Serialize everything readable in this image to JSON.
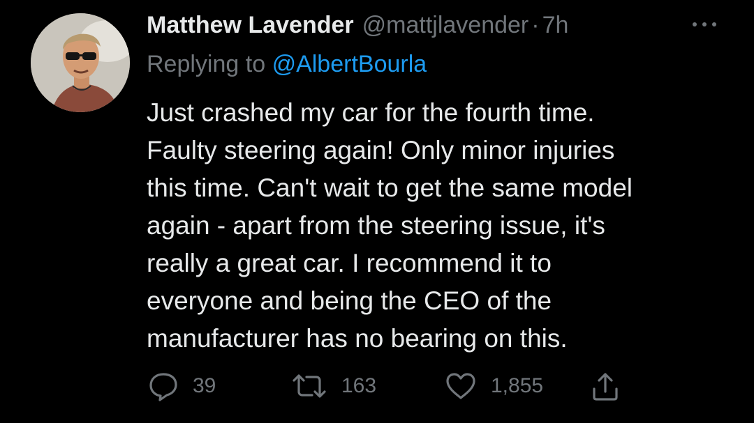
{
  "tweet": {
    "author": {
      "display_name": "Matthew Lavender",
      "handle": "@mattjlavender",
      "separator": "·",
      "time": "7h",
      "avatar_icon": "profile-photo"
    },
    "reply": {
      "prefix": "Replying to",
      "handle": "@AlbertBourla"
    },
    "body_lines": [
      "Just crashed my car for the fourth time.",
      "Faulty steering again! Only minor injuries",
      "this time. Can't wait to get the same model",
      "again - apart from the steering issue, it's",
      "really a great car. I recommend it to",
      "everyone and being the CEO of the",
      "manufacturer has no bearing on this."
    ],
    "actions": {
      "reply": {
        "icon": "comment-icon",
        "count": "39"
      },
      "retweet": {
        "icon": "retweet-icon",
        "count": "163"
      },
      "like": {
        "icon": "heart-icon",
        "count": "1,855"
      },
      "share": {
        "icon": "share-icon"
      }
    },
    "more_icon": "more-options-icon"
  },
  "colors": {
    "background": "#000000",
    "text_primary": "#e7e9ea",
    "text_secondary": "#71767b",
    "link": "#1d9bf0"
  }
}
